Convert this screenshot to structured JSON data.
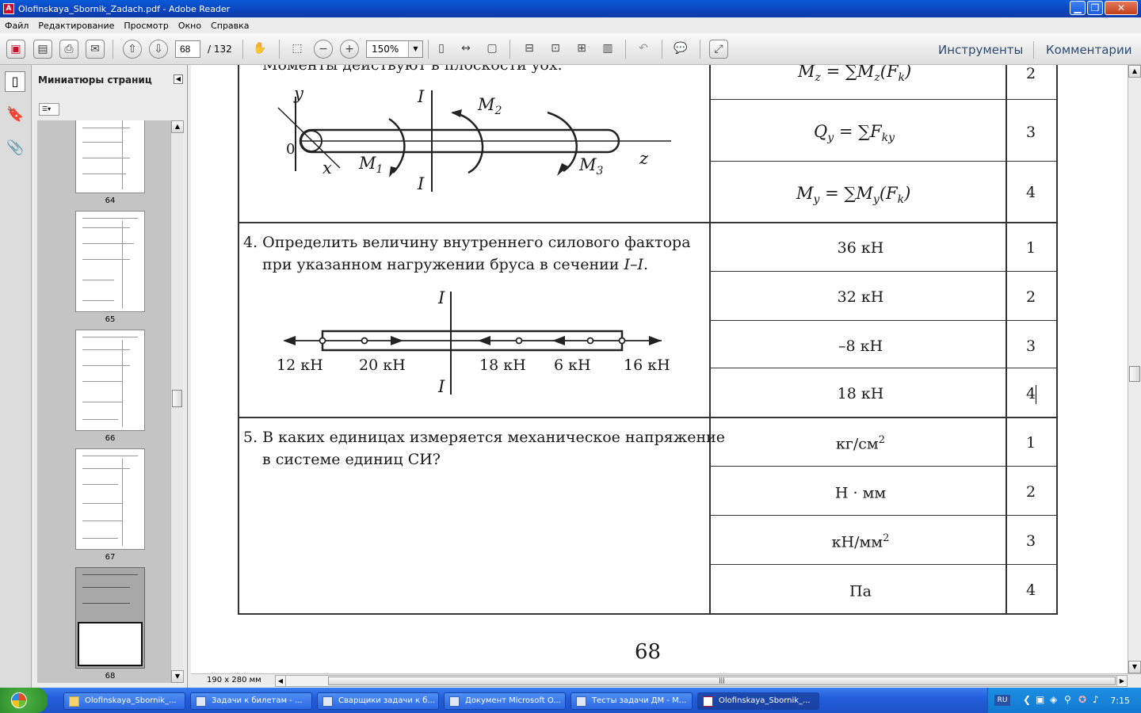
{
  "window": {
    "title": "Olofinskaya_Sbornik_Zadach.pdf - Adobe Reader",
    "minimize": "▁",
    "maximize": "❐",
    "close": "✕"
  },
  "menu": [
    "Файл",
    "Редактирование",
    "Просмотр",
    "Окно",
    "Справка"
  ],
  "toolbar": {
    "current_page": "68",
    "total_pages": "/ 132",
    "zoom": "150%",
    "tools_label": "Инструменты",
    "comments_label": "Комментарии"
  },
  "icons": {
    "create": "create-pdf-icon",
    "save": "save-icon",
    "print": "print-icon",
    "email": "email-icon",
    "prev": "arrow-up-icon",
    "next": "arrow-down-icon",
    "hand": "hand-icon",
    "marquee": "marquee-zoom-icon",
    "zoomout": "zoom-out-icon",
    "zoomin": "zoom-in-icon",
    "comment": "comment-icon",
    "expand": "expand-icon"
  },
  "sidebar": {
    "title": "Миниатюры страниц",
    "thumbnails": [
      {
        "label": "64"
      },
      {
        "label": "65"
      },
      {
        "label": "66"
      },
      {
        "label": "67"
      },
      {
        "label": "68"
      }
    ]
  },
  "document": {
    "top_cut_text": "Моменты действуют в плоскости yox.",
    "fig1": {
      "y": "y",
      "I_top": "I",
      "I_bottom": "I",
      "M2": "M",
      "M2sub": "2",
      "M1": "M",
      "M1sub": "1",
      "M3": "M",
      "M3sub": "3",
      "zero": "0",
      "x": "x",
      "z": "z"
    },
    "formulas": [
      {
        "text": "M",
        "sub": "z",
        "rest": " = ∑M",
        "sub2": "z",
        "tail": "(F",
        "sub3": "k",
        "end": ")",
        "num": "2"
      },
      {
        "text": "Q",
        "sub": "y",
        "rest": " = ∑F",
        "sub2": "ky",
        "tail": "",
        "sub3": "",
        "end": "",
        "num": "3"
      },
      {
        "text": "M",
        "sub": "y",
        "rest": " = ∑M",
        "sub2": "y",
        "tail": "(F",
        "sub3": "k",
        "end": ")",
        "num": "4"
      }
    ],
    "q4": {
      "line1": "4. Определить величину внутреннего силового фактора",
      "line2": "при указанном нагружении бруса в сечении ",
      "line2_italic": "I–I",
      "line2_end": ".",
      "loads": [
        "12 кН",
        "20 кН",
        "18 кН",
        "6 кН",
        "16 кН"
      ],
      "I_top": "I",
      "I_bottom": "I",
      "answers": [
        {
          "value": "36 кН",
          "num": "1"
        },
        {
          "value": "32 кН",
          "num": "2"
        },
        {
          "value": "–8 кН",
          "num": "3"
        },
        {
          "value": "18 кН",
          "num": "4"
        }
      ]
    },
    "q5": {
      "line1": "5. В каких единицах измеряется механическое напряжение",
      "line2": "в системе единиц СИ?",
      "answers": [
        {
          "value": "кг/см",
          "sup": "2",
          "num": "1"
        },
        {
          "value": "Н · мм",
          "sup": "",
          "num": "2"
        },
        {
          "value": "кН/мм",
          "sup": "2",
          "num": "3"
        },
        {
          "value": "Па",
          "sup": "",
          "num": "4"
        }
      ]
    },
    "page_number": "68"
  },
  "status": {
    "page_size": "190 x 280 мм"
  },
  "taskbar": {
    "tasks": [
      {
        "label": "Olofinskaya_Sbornik_..."
      },
      {
        "label": "Задачи к билетам - ..."
      },
      {
        "label": "Сварщики задачи к б..."
      },
      {
        "label": "Документ Microsoft O..."
      },
      {
        "label": "Тесты задачи ДМ - М..."
      },
      {
        "label": "Olofinskaya_Sbornik_..."
      }
    ],
    "lang": "RU",
    "clock": "7:15"
  },
  "colors": {
    "titlebar": "#0d47c1",
    "taskbar": "#245edb",
    "accent_link": "#2e4a72"
  }
}
